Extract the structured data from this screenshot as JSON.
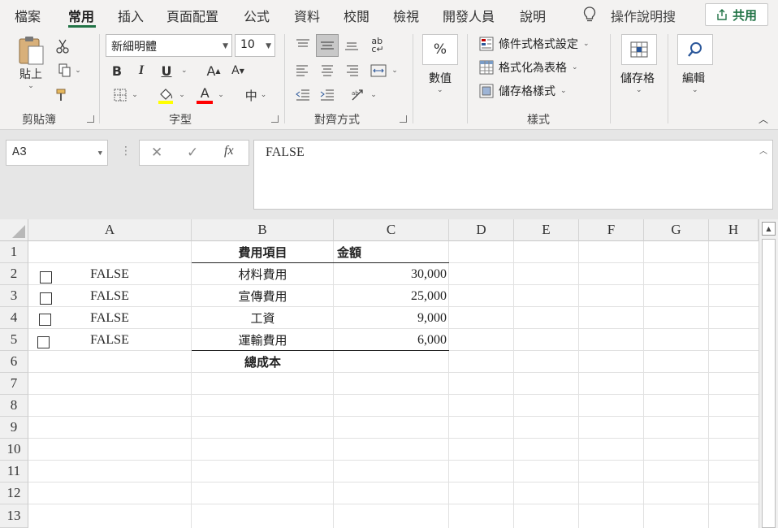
{
  "ribbon_tabs": [
    "檔案",
    "常用",
    "插入",
    "頁面配置",
    "公式",
    "資料",
    "校閱",
    "檢視",
    "開發人員",
    "說明"
  ],
  "active_tab": "常用",
  "tell_me": "操作說明搜",
  "share_label": "共用",
  "clipboard": {
    "paste_label": "貼上",
    "group_label": "剪貼簿"
  },
  "font": {
    "name": "新細明體",
    "size": "10",
    "group_label": "字型",
    "bold": "B",
    "italic": "I",
    "underline": "U",
    "grow": "A",
    "shrink": "A",
    "color_glyph": "A",
    "phonetic_glyph": "中"
  },
  "alignment": {
    "group_label": "對齊方式"
  },
  "number": {
    "label": "數值",
    "percent_glyph": "%"
  },
  "styles": {
    "conditional": "條件式格式設定",
    "as_table": "格式化為表格",
    "cell_styles": "儲存格樣式",
    "group_label": "樣式"
  },
  "cells": {
    "label": "儲存格"
  },
  "editing": {
    "label": "編輯"
  },
  "colors": {
    "accent": "#217346",
    "fill_highlight": "#ffff00",
    "font_color": "#ff0000"
  },
  "name_box": "A3",
  "formula_bar": {
    "cancel": "✕",
    "enter": "✓",
    "fx": "fx",
    "content": "FALSE"
  },
  "columns": [
    "A",
    "B",
    "C",
    "D",
    "E",
    "F",
    "G",
    "H"
  ],
  "rows": [
    "1",
    "2",
    "3",
    "4",
    "5",
    "6",
    "7",
    "8",
    "9",
    "10",
    "11",
    "12",
    "13"
  ],
  "sheet": {
    "header_b": "費用項目",
    "header_c": "金額",
    "items": [
      {
        "a": "FALSE",
        "b": "材料費用",
        "c": "30,000"
      },
      {
        "a": "FALSE",
        "b": "宣傳費用",
        "c": "25,000"
      },
      {
        "a": "FALSE",
        "b": "工資",
        "c": "9,000"
      },
      {
        "a": "FALSE",
        "b": "運輸費用",
        "c": "6,000"
      }
    ],
    "total_label": "總成本"
  }
}
